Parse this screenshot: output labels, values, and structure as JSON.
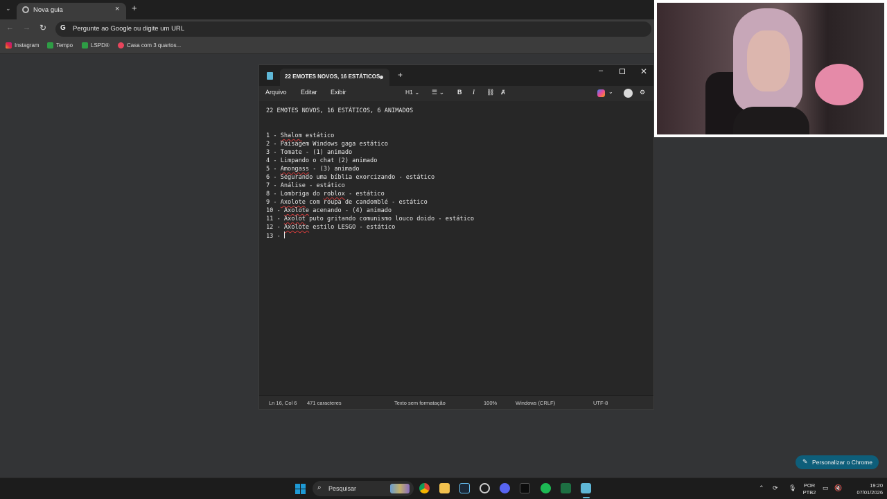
{
  "browser": {
    "tab_title": "Nova guia",
    "omnibox_placeholder": "Pergunte ao Google ou digite um URL",
    "bookmarks": [
      "Instagram",
      "Tempo",
      "LSPD®",
      "Casa com 3 quartos..."
    ],
    "personalize_label": "Personalizar o Chrome"
  },
  "notepad": {
    "tab_title": "22 EMOTES NOVOS, 16 ESTÁTICOS,",
    "menu": [
      "Arquivo",
      "Editar",
      "Exibir"
    ],
    "heading_format": "H1",
    "heading": "22 EMOTES NOVOS, 16 ESTÁTICOS, 6 ANIMADOS",
    "lines": [
      [
        [
          "1 - ",
          false
        ],
        [
          "Shalom",
          true
        ],
        [
          " estático",
          false
        ]
      ],
      [
        [
          "2 - ",
          false
        ],
        [
          "Paisagem Windows gaga estático",
          false
        ]
      ],
      [
        [
          "3 - ",
          false
        ],
        [
          "Tomate - (1) animado",
          false
        ]
      ],
      [
        [
          "4 - ",
          false
        ],
        [
          "Limpando o chat (2) animado",
          false
        ]
      ],
      [
        [
          "5 - ",
          false
        ],
        [
          "Amongass",
          true
        ],
        [
          " - (3) animado",
          false
        ]
      ],
      [
        [
          "6 - ",
          false
        ],
        [
          "Segurando uma bíblia exorcizando - estático",
          false
        ]
      ],
      [
        [
          "7 - ",
          false
        ],
        [
          "Análise - estático",
          false
        ]
      ],
      [
        [
          "8 - ",
          false
        ],
        [
          "Lombriga do ",
          false
        ],
        [
          "roblox",
          true
        ],
        [
          " - estático",
          false
        ]
      ],
      [
        [
          "9 - ",
          false
        ],
        [
          "Axolote",
          true
        ],
        [
          " com roupa de candomblé - estático",
          false
        ]
      ],
      [
        [
          "10 - ",
          false
        ],
        [
          "Axolote",
          true
        ],
        [
          " acenando - (4) animado",
          false
        ]
      ],
      [
        [
          "11 - ",
          false
        ],
        [
          "Axolot",
          true
        ],
        [
          " puto gritando comunismo louco doido - estático",
          false
        ]
      ],
      [
        [
          "12 - ",
          false
        ],
        [
          "Axolote",
          true
        ],
        [
          " estilo LESGO - estático",
          false
        ]
      ],
      [
        [
          "13 - ",
          false
        ]
      ]
    ],
    "status": {
      "position": "Ln 16, Col 6",
      "chars": "471 caracteres",
      "format": "Texto sem formatação",
      "zoom": "100%",
      "line_endings": "Windows (CRLF)",
      "encoding": "UTF-8"
    }
  },
  "taskbar": {
    "search_label": "Pesquisar",
    "lang_top": "POR",
    "lang_bottom": "PTB2",
    "time": "19:20",
    "date": "07/01/2026"
  },
  "colors": {
    "chrome_bg": "#333436",
    "notepad_bg": "#272727",
    "accent": "#0e5e7a",
    "spell_error": "#d13b3b"
  }
}
